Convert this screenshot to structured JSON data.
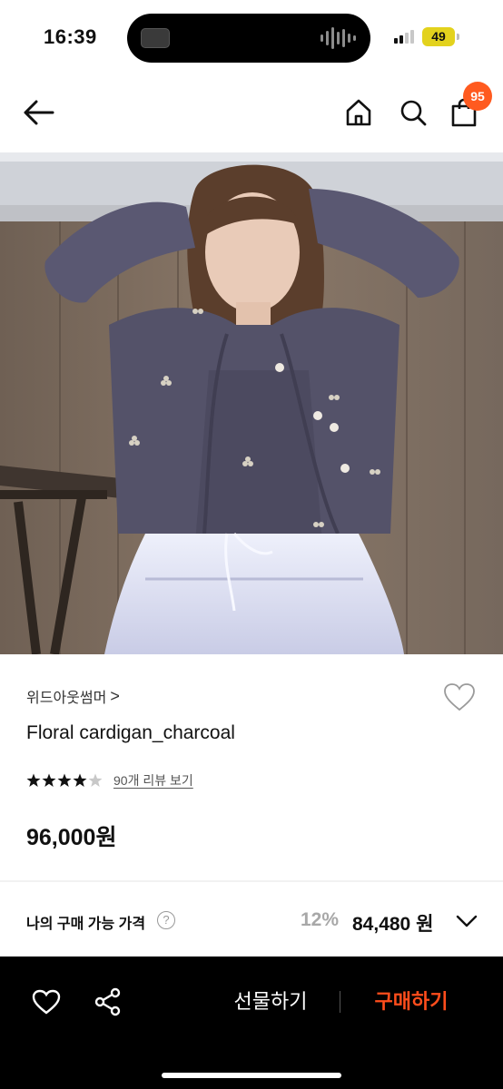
{
  "status_bar": {
    "time": "16:39",
    "battery": "49"
  },
  "header": {
    "back_icon": "arrow-left-icon",
    "home_icon": "home-icon",
    "search_icon": "search-icon",
    "cart_icon": "shopping-bag-icon",
    "cart_badge": "95",
    "badge_color": "#ff5a1f"
  },
  "hero": {
    "image_subject": "model wearing charcoal floral knit cardigan with matching knit top and white skirt"
  },
  "product": {
    "brand": "위드아웃썸머",
    "brand_chevron": ">",
    "title": "Floral cardigan_charcoal",
    "rating_stars": "★★★★★",
    "rating_value": 4.5,
    "review_link": "90개 리뷰 보기",
    "price": "96,000원",
    "wishlist_icon": "heart-outline-icon"
  },
  "my_price": {
    "label": "나의 구매 가능 가격",
    "help_icon": "?",
    "discount_rate": "12%",
    "discount_price": "84,480 원",
    "expand_icon": "chevron-down-icon"
  },
  "bottom_bar": {
    "like_icon": "heart-outline-icon",
    "share_icon": "share-icon",
    "gift_label": "선물하기",
    "buy_label": "구매하기",
    "buy_color": "#ff4d1c"
  }
}
